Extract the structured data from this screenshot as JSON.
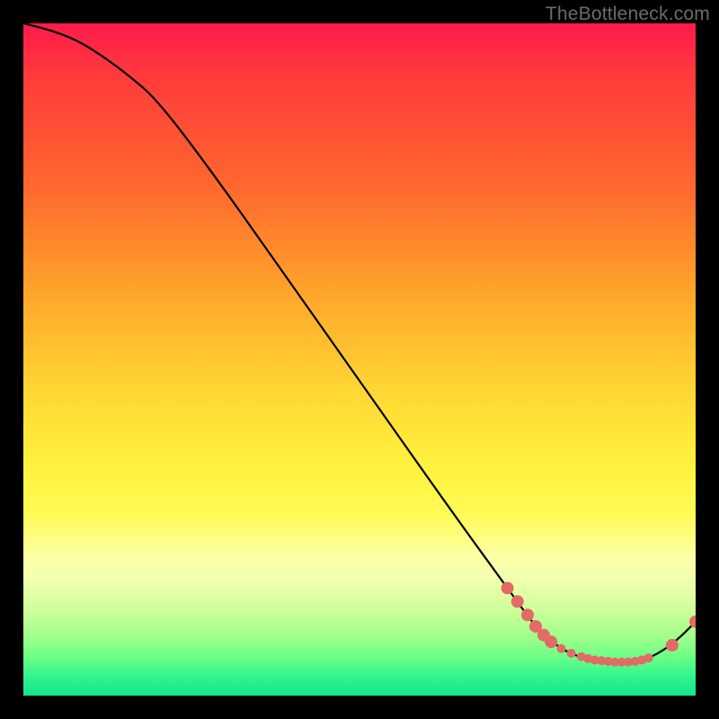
{
  "watermark": "TheBottleneck.com",
  "chart_data": {
    "type": "line",
    "title": "",
    "xlabel": "",
    "ylabel": "",
    "xlim": [
      0,
      100
    ],
    "ylim": [
      0,
      100
    ],
    "grid": false,
    "series": [
      {
        "name": "curve",
        "x": [
          0,
          4,
          8,
          12,
          16,
          20,
          28,
          40,
          52,
          64,
          72,
          76,
          78,
          80,
          82,
          84,
          86,
          88,
          90,
          92,
          94,
          97,
          100
        ],
        "values": [
          100,
          99,
          97.5,
          95,
          92,
          88.5,
          78,
          61,
          44,
          27,
          16,
          10.5,
          8.5,
          7,
          6,
          5.5,
          5.2,
          5,
          5,
          5.3,
          6,
          8,
          11
        ]
      }
    ],
    "markers": [
      {
        "x": 72.0,
        "y": 16.0
      },
      {
        "x": 73.5,
        "y": 14.0
      },
      {
        "x": 75.0,
        "y": 12.0
      },
      {
        "x": 76.2,
        "y": 10.3
      },
      {
        "x": 77.4,
        "y": 9.0
      },
      {
        "x": 78.5,
        "y": 8.0
      },
      {
        "x": 80.0,
        "y": 7.0
      },
      {
        "x": 81.5,
        "y": 6.3
      },
      {
        "x": 83.0,
        "y": 5.8
      },
      {
        "x": 84.0,
        "y": 5.5
      },
      {
        "x": 85.0,
        "y": 5.3
      },
      {
        "x": 86.0,
        "y": 5.2
      },
      {
        "x": 87.0,
        "y": 5.1
      },
      {
        "x": 88.0,
        "y": 5.0
      },
      {
        "x": 89.0,
        "y": 5.0
      },
      {
        "x": 90.0,
        "y": 5.0
      },
      {
        "x": 91.0,
        "y": 5.1
      },
      {
        "x": 92.0,
        "y": 5.3
      },
      {
        "x": 93.0,
        "y": 5.6
      },
      {
        "x": 96.5,
        "y": 7.5
      },
      {
        "x": 100.0,
        "y": 11.0
      }
    ],
    "marker_style": {
      "fill": "#e46a66",
      "radius_small": 5,
      "radius_large": 7
    },
    "line_color": "#000000"
  }
}
